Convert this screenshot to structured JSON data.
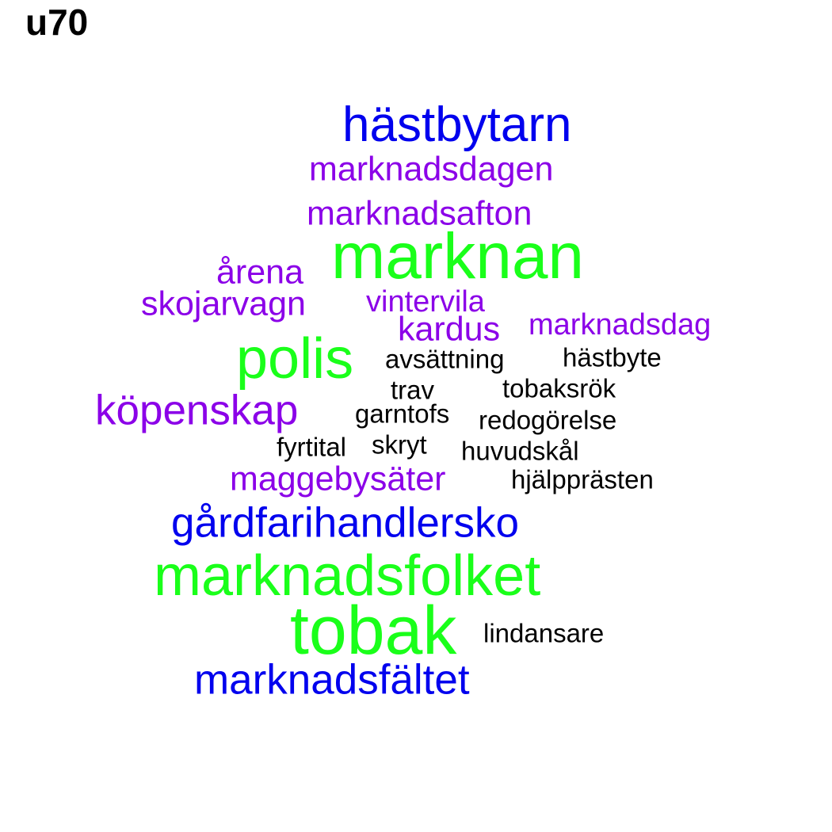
{
  "title": "u70",
  "colors": {
    "green": "#1aff1a",
    "blue": "#0000ee",
    "purple": "#8b00e8",
    "black": "#000000"
  },
  "words": [
    "hästbytarn",
    "marknadsdagen",
    "marknadsafton",
    "marknan",
    "årena",
    "skojarvagn",
    "vintervila",
    "kardus",
    "marknadsdag",
    "polis",
    "avsättning",
    "hästbyte",
    "trav",
    "tobaksrök",
    "köpenskap",
    "garntofs",
    "redogörelse",
    "fyrtital",
    "skryt",
    "huvudskål",
    "maggebysäter",
    "hjälpprästen",
    "gårdfarihandlersko",
    "marknadsfolket",
    "tobak",
    "lindansare",
    "marknadsfältet"
  ]
}
